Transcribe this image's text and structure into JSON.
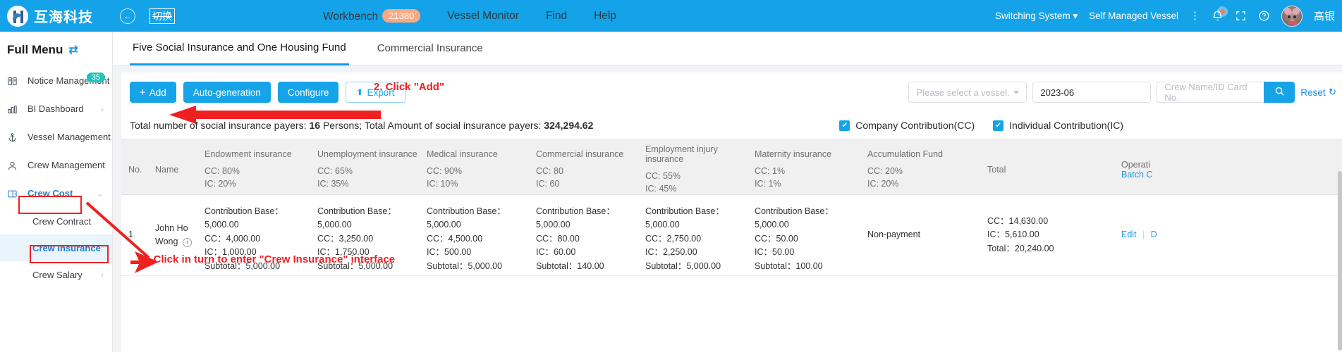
{
  "header": {
    "logo_text": "互海科技",
    "back_icon": "back-arrow-icon",
    "switch_label": "切换",
    "nav": [
      {
        "label": "Workbench",
        "badge": "21380"
      },
      {
        "label": "Vessel Monitor",
        "badge": ""
      },
      {
        "label": "Find",
        "badge": ""
      },
      {
        "label": "Help",
        "badge": ""
      }
    ],
    "switching_system": "Switching System",
    "self_managed_vessel": "Self Managed Vessel",
    "user_name": "高银"
  },
  "sidebar": {
    "title": "Full Menu",
    "items": [
      {
        "label": "Notice Management",
        "icon": "book-icon",
        "badge": "35",
        "chevron": false
      },
      {
        "label": "BI Dashboard",
        "icon": "bar-chart-icon",
        "badge": "",
        "chevron": true
      },
      {
        "label": "Vessel Management",
        "icon": "anchor-icon",
        "badge": "",
        "chevron": true
      },
      {
        "label": "Crew Management",
        "icon": "person-icon",
        "badge": "",
        "chevron": true
      },
      {
        "label": "Crew Cost",
        "icon": "wallet-icon",
        "badge": "",
        "chevron": true
      }
    ],
    "sub_items": [
      {
        "label": "Crew Contract",
        "chevron": false,
        "active": false
      },
      {
        "label": "Crew Insurance",
        "chevron": false,
        "active": true
      },
      {
        "label": "Crew Salary",
        "chevron": true,
        "active": false
      }
    ]
  },
  "tabs": [
    {
      "label": "Five Social Insurance and One Housing Fund",
      "active": true
    },
    {
      "label": "Commercial Insurance",
      "active": false
    }
  ],
  "toolbar": {
    "add_label": "Add",
    "auto_generation_label": "Auto-generation",
    "configure_label": "Configure",
    "export_label": "Export",
    "vessel_placeholder": "Please select a vessel.",
    "date_value": "2023-06",
    "search_placeholder": "Crew Name/ID Card No.",
    "reset_label": "Reset"
  },
  "summary": {
    "text_part1": "Total number of social insurance payers:",
    "count": "16",
    "text_part2": "Persons; Total Amount of social insurance payers:",
    "amount": "324,294.62",
    "cc_checkbox": "Company Contribution(CC)",
    "ic_checkbox": "Individual Contribution(IC)"
  },
  "table": {
    "headers": {
      "no": "No.",
      "name": "Name",
      "total": "Total",
      "operation": "Operati",
      "batch": "Batch C"
    },
    "columns": [
      {
        "name": "Endowment insurance",
        "cc": "CC: 80%",
        "ic": "IC: 20%"
      },
      {
        "name": "Unemployment insurance",
        "cc": "CC: 65%",
        "ic": "IC: 35%"
      },
      {
        "name": "Medical insurance",
        "cc": "CC: 90%",
        "ic": "IC: 10%"
      },
      {
        "name": "Commercial insurance",
        "cc": "CC: 80",
        "ic": "IC: 60"
      },
      {
        "name": "Employment injury insurance",
        "cc": "CC: 55%",
        "ic": "IC: 45%"
      },
      {
        "name": "Maternity insurance",
        "cc": "CC: 1%",
        "ic": "IC: 1%"
      },
      {
        "name": "Accumulation Fund",
        "cc": "CC: 20%",
        "ic": "IC: 20%"
      }
    ],
    "rows": [
      {
        "no": "1",
        "name": "John Ho Wong",
        "endowment": {
          "base": "Contribution Base：5,000.00",
          "cc": "CC：4,000.00",
          "ic": "IC：1,000.00",
          "subtotal": "Subtotal：5,000.00"
        },
        "unemployment": {
          "base": "Contribution Base：5,000.00",
          "cc": "CC：3,250.00",
          "ic": "IC：1,750.00",
          "subtotal": "Subtotal：5,000.00"
        },
        "medical": {
          "base": "Contribution Base：5,000.00",
          "cc": "CC：4,500.00",
          "ic": "IC：500.00",
          "subtotal": "Subtotal：5,000.00"
        },
        "commercial": {
          "base": "Contribution Base：5,000.00",
          "cc": "CC：80.00",
          "ic": "IC：60.00",
          "subtotal": "Subtotal：140.00"
        },
        "injury": {
          "base": "Contribution Base：5,000.00",
          "cc": "CC：2,750.00",
          "ic": "IC：2,250.00",
          "subtotal": "Subtotal：5,000.00"
        },
        "maternity": {
          "base": "Contribution Base：5,000.00",
          "cc": "CC：50.00",
          "ic": "IC：50.00",
          "subtotal": "Subtotal：100.00"
        },
        "accumulation": "Non-payment",
        "total": {
          "cc": "CC：14,630.00",
          "ic": "IC：5,610.00",
          "total": "Total：20,240.00"
        },
        "edit": "Edit",
        "delete": "D"
      }
    ]
  },
  "annotations": [
    {
      "id": "step2",
      "text": "2. Click \"Add\""
    },
    {
      "id": "step1",
      "text": "1.Click in turn to enter \"Crew Insurance\" interface"
    }
  ],
  "colors": {
    "brand_blue": "#14a3e8",
    "accent_link": "#1e9ae0",
    "annotation_red": "#f02020",
    "badge_orange": "#ffa880",
    "badge_teal": "#1fc4bd"
  }
}
